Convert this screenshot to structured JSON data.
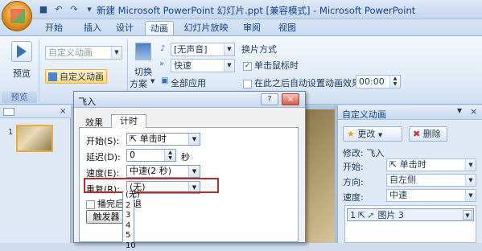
{
  "window": {
    "title": "新建 Microsoft PowerPoint 幻灯片.ppt [兼容模式] - Microsoft PowerPoint",
    "qat_icons": [
      "save-icon",
      "undo-icon",
      "redo-icon",
      "customize-icon"
    ],
    "qat_glyphs": [
      "■",
      "↶",
      "↷",
      "▾"
    ]
  },
  "ribbon": {
    "tabs": [
      "开始",
      "插入",
      "设计",
      "动画",
      "幻灯片放映",
      "审阅",
      "视图"
    ],
    "active_tab": "动画",
    "preview": {
      "label": "预览",
      "group": "预览"
    },
    "animation_group": {
      "custom_animation_combo": "自定义动画",
      "custom_animation_button": "自定义动画"
    },
    "transition": {
      "switch_label": "切换",
      "scheme_label": "方案",
      "sound": "[无声音]",
      "speed": "快速",
      "apply_all": "全部应用"
    },
    "advance": {
      "title": "换片方式",
      "on_click": "单击鼠标时",
      "on_click_checked": true,
      "after_auto": "在此之后自动设置动画效果:",
      "after_auto_checked": false,
      "time": "00:00"
    }
  },
  "thumbnails": {
    "slide_number": "1"
  },
  "dialog": {
    "title": "飞入",
    "help": "?",
    "close": "×",
    "tabs": [
      "效果",
      "计时"
    ],
    "active_tab": "计时",
    "fields": {
      "start_label": "开始(S):",
      "start_value": "单击时",
      "delay_label": "延迟(D):",
      "delay_value": "0",
      "delay_unit": "秒",
      "speed_label": "速度(E):",
      "speed_value": "中速(2 秒)",
      "repeat_label": "重复(R):",
      "repeat_value": "(无)",
      "rewind_label": "播完后快退",
      "trigger_button": "触发器"
    },
    "repeat_options": [
      "(无)",
      "2",
      "3",
      "4",
      "5",
      "10"
    ]
  },
  "task_pane": {
    "title": "自定义动画",
    "change_button": "更改",
    "remove_button": "删除",
    "modify_label": "修改: 飞入",
    "start_label": "开始:",
    "start_value": "单击时",
    "direction_label": "方向:",
    "direction_value": "自左侧",
    "speed_label": "速度:",
    "speed_value": "中速",
    "list_item": "1",
    "list_item_label": "图片 3"
  },
  "colors": {
    "highlight_box": "#c0282d",
    "ribbon_accent": "#15428b"
  }
}
